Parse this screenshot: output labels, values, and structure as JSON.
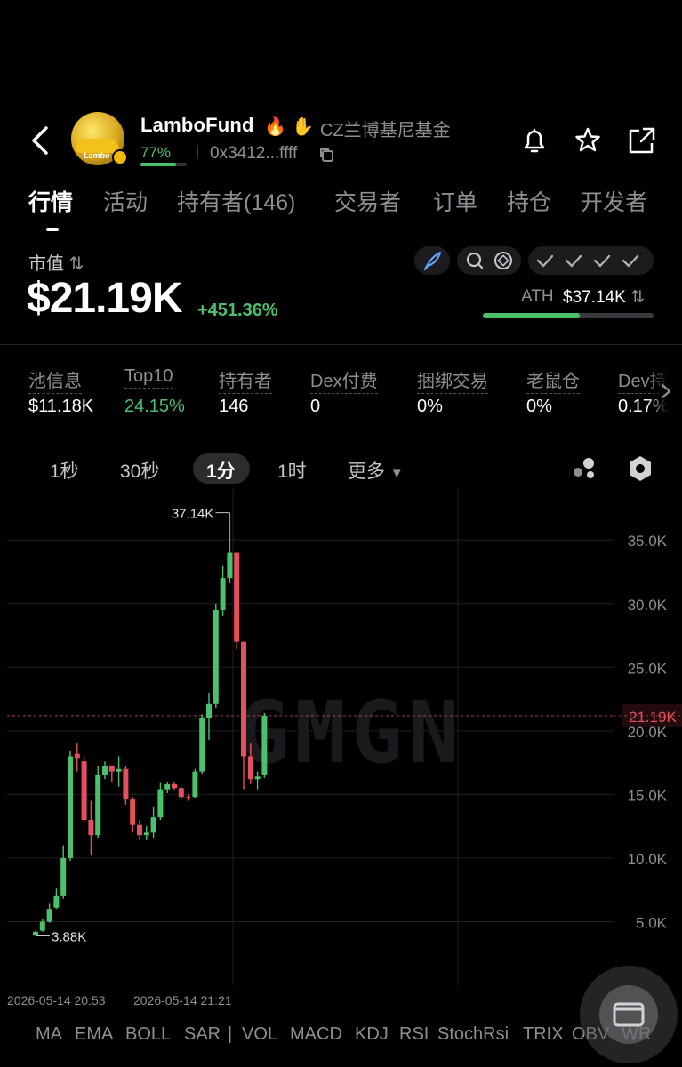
{
  "header": {
    "token_name": "LamboFund",
    "token_fullname": "CZ兰博基尼基金",
    "progress_pct": "77%",
    "progress_value": 0.77,
    "address": "0x3412...ffff",
    "icons": [
      "back-arrow-icon",
      "fire-icon",
      "hand-icon",
      "copy-icon",
      "bell-icon",
      "star-icon",
      "share-icon"
    ]
  },
  "tabs": [
    {
      "label": "行情",
      "active": true
    },
    {
      "label": "活动"
    },
    {
      "label": "持有者(146)"
    },
    {
      "label": "交易者"
    },
    {
      "label": "订单"
    },
    {
      "label": "持仓"
    },
    {
      "label": "开发者"
    }
  ],
  "market": {
    "label": "市值",
    "value": "$21.19K",
    "change": "+451.36%",
    "ath_label": "ATH",
    "ath_value": "$37.14K",
    "ath_ratio": 0.57
  },
  "stats": [
    {
      "label": "池信息",
      "value": "$11.18K"
    },
    {
      "label": "Top10",
      "value": "24.15%",
      "color": "#4cc16c"
    },
    {
      "label": "持有者",
      "value": "146"
    },
    {
      "label": "Dex付费",
      "value": "0"
    },
    {
      "label": "捆绑交易",
      "value": "0%"
    },
    {
      "label": "老鼠仓",
      "value": "0%"
    },
    {
      "label": "Dev持仓",
      "value": "0.17%"
    }
  ],
  "timeframes": [
    {
      "label": "1秒"
    },
    {
      "label": "30秒"
    },
    {
      "label": "1分",
      "active": true
    },
    {
      "label": "1时"
    },
    {
      "label": "更多"
    }
  ],
  "chart_data": {
    "type": "candlestick",
    "y_ticks": [
      "35.0K",
      "30.0K",
      "25.0K",
      "20.0K",
      "15.0K",
      "10.0K",
      "5.0K"
    ],
    "ylim": [
      0,
      39000
    ],
    "current_price": 21190,
    "current_label": "21.19K",
    "max_label": "37.14K",
    "min_label": "3.88K",
    "x_ticks": [
      "2026-05-14 20:53",
      "2026-05-14 21:21"
    ],
    "watermark": "GMGN",
    "colors": {
      "up": "#4cc16c",
      "down": "#e4505e"
    },
    "candles": [
      {
        "o": 3900,
        "c": 4200,
        "h": 4300,
        "l": 3880
      },
      {
        "o": 4300,
        "c": 5000,
        "h": 5200,
        "l": 4200
      },
      {
        "o": 5000,
        "c": 6000,
        "h": 6400,
        "l": 4900
      },
      {
        "o": 6100,
        "c": 7000,
        "h": 7600,
        "l": 6000
      },
      {
        "o": 7000,
        "c": 10000,
        "h": 11000,
        "l": 6800
      },
      {
        "o": 10000,
        "c": 18000,
        "h": 18400,
        "l": 9800
      },
      {
        "o": 18200,
        "c": 17800,
        "h": 19000,
        "l": 16800
      },
      {
        "o": 17600,
        "c": 13000,
        "h": 18000,
        "l": 12800
      },
      {
        "o": 13000,
        "c": 11800,
        "h": 14500,
        "l": 10200
      },
      {
        "o": 11800,
        "c": 16500,
        "h": 17200,
        "l": 11600
      },
      {
        "o": 16500,
        "c": 17200,
        "h": 17600,
        "l": 16200
      },
      {
        "o": 17200,
        "c": 16800,
        "h": 17300,
        "l": 16000
      },
      {
        "o": 16800,
        "c": 17000,
        "h": 18000,
        "l": 15600
      },
      {
        "o": 17000,
        "c": 14600,
        "h": 17200,
        "l": 14200
      },
      {
        "o": 14600,
        "c": 12600,
        "h": 14800,
        "l": 12000
      },
      {
        "o": 12600,
        "c": 11800,
        "h": 13000,
        "l": 11400
      },
      {
        "o": 11800,
        "c": 12000,
        "h": 12500,
        "l": 11400
      },
      {
        "o": 12000,
        "c": 13200,
        "h": 14000,
        "l": 11600
      },
      {
        "o": 13200,
        "c": 15400,
        "h": 15900,
        "l": 13000
      },
      {
        "o": 15400,
        "c": 15800,
        "h": 16000,
        "l": 15100
      },
      {
        "o": 15800,
        "c": 15500,
        "h": 16000,
        "l": 15300
      },
      {
        "o": 15500,
        "c": 14800,
        "h": 15600,
        "l": 14600
      },
      {
        "o": 14800,
        "c": 14700,
        "h": 15000,
        "l": 14500
      },
      {
        "o": 14800,
        "c": 16800,
        "h": 17000,
        "l": 14700
      },
      {
        "o": 16800,
        "c": 21000,
        "h": 21300,
        "l": 16600
      },
      {
        "o": 21000,
        "c": 22100,
        "h": 23000,
        "l": 19300
      },
      {
        "o": 22100,
        "c": 29500,
        "h": 30000,
        "l": 21800
      },
      {
        "o": 29500,
        "c": 32000,
        "h": 33000,
        "l": 29000
      },
      {
        "o": 32000,
        "c": 34000,
        "h": 37140,
        "l": 31600
      },
      {
        "o": 34000,
        "c": 27000,
        "h": 34000,
        "l": 26400
      },
      {
        "o": 27000,
        "c": 18000,
        "h": 27000,
        "l": 15400
      },
      {
        "o": 18000,
        "c": 16200,
        "h": 19000,
        "l": 15800
      },
      {
        "o": 16200,
        "c": 16400,
        "h": 16800,
        "l": 15400
      },
      {
        "o": 16500,
        "c": 21190,
        "h": 21400,
        "l": 16300
      }
    ]
  },
  "indicators": [
    "MA",
    "EMA",
    "BOLL",
    "SAR",
    "|",
    "VOL",
    "MACD",
    "KDJ",
    "RSI",
    "StochRsi",
    "TRIX",
    "OBV",
    "WR"
  ]
}
